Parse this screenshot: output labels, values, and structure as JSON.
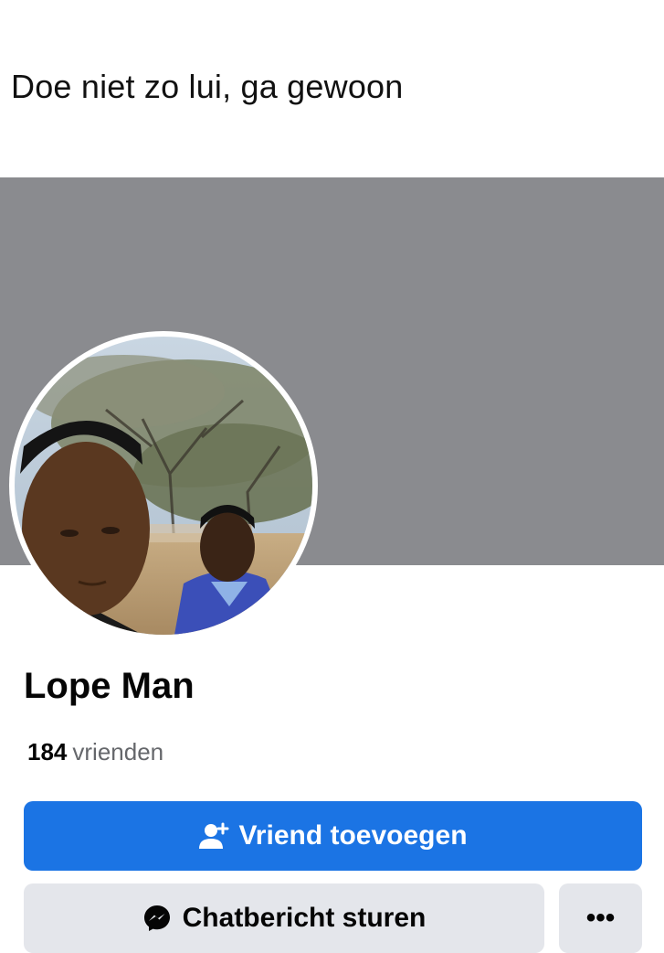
{
  "caption": "Doe niet zo lui, ga gewoon",
  "profile": {
    "name": "Lope Man",
    "friends_count": "184",
    "friends_label": "vrienden"
  },
  "actions": {
    "add_friend_label": "Vriend toevoegen",
    "add_friend_icon": "add-friend-icon",
    "message_label": "Chatbericht sturen",
    "message_icon": "messenger-icon",
    "more_label": "•••"
  },
  "colors": {
    "cover": "#8a8b8f",
    "primary_button": "#1b74e4",
    "secondary_button": "#e4e6eb",
    "muted_text": "#65676b"
  }
}
